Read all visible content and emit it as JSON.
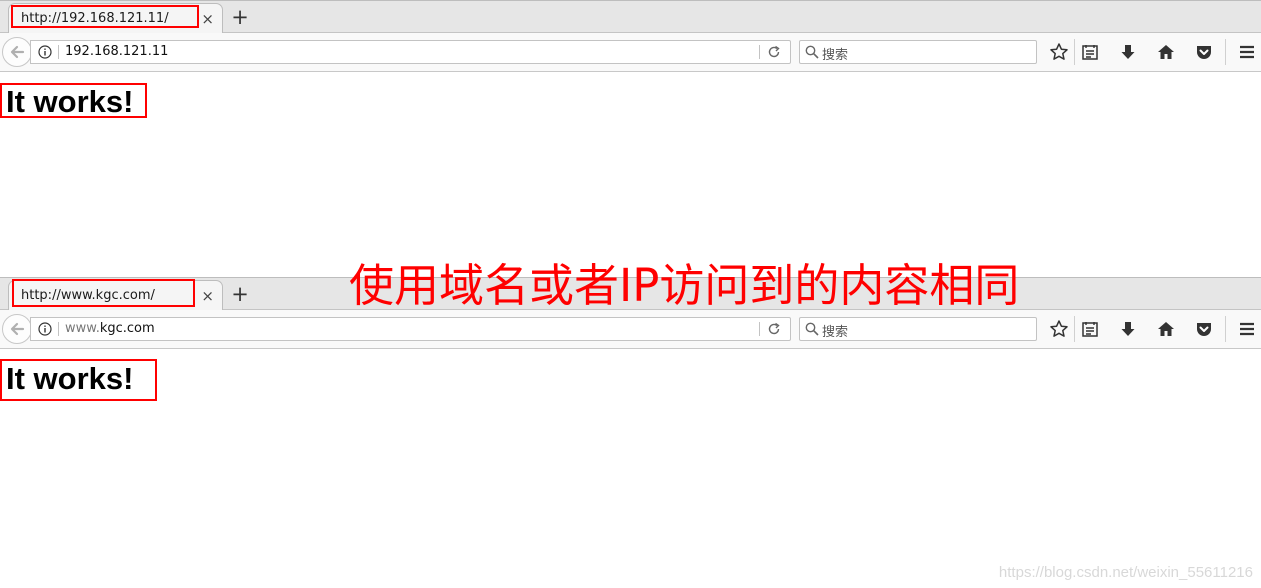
{
  "windows": [
    {
      "tab": {
        "title": "http://192.168.121.11/",
        "close": "×"
      },
      "new_tab": "+",
      "url": {
        "dim": "",
        "main": "192.168.121.11"
      },
      "search_placeholder": "搜索",
      "content": {
        "heading": "It works!"
      }
    },
    {
      "tab": {
        "title": "http://www.kgc.com/",
        "close": "×"
      },
      "new_tab": "+",
      "url": {
        "dim": "www.",
        "main": "kgc.com"
      },
      "search_placeholder": "搜索",
      "content": {
        "heading": "It works!"
      }
    }
  ],
  "annotation": "使用域名或者IP访问到的内容相同",
  "watermark": "https://blog.csdn.net/weixin_55611216",
  "colors": {
    "annotation_red": "#ff0000",
    "chrome_bg": "#e6e6e6",
    "navbar_bg": "#f9f9f9"
  },
  "icons": [
    "back-arrow-icon",
    "info-icon",
    "reload-icon",
    "search-icon",
    "bookmark-star-icon",
    "reading-list-icon",
    "download-icon",
    "home-icon",
    "pocket-icon",
    "menu-icon"
  ]
}
